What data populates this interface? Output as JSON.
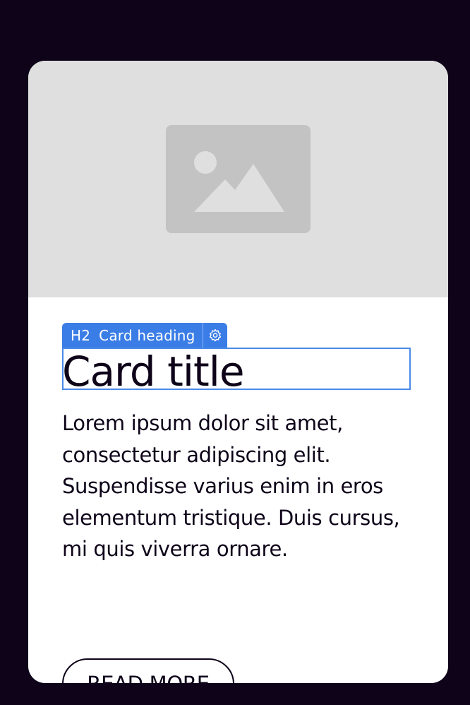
{
  "card": {
    "image": {
      "icon": "image-placeholder-icon",
      "background_color": "#dfdfdf",
      "icon_color": "#c3c3c3"
    },
    "heading_toolbar": {
      "tag": "H2",
      "label": "Card heading",
      "settings_icon": "gear-icon",
      "accent_color": "#3b7de6"
    },
    "title": "Card title",
    "text": "Lorem ipsum dolor sit amet, consectetur adipiscing elit. Suspendisse varius enim in eros elementum tristique. Duis cursus, mi quis viverra ornare.",
    "button_label": "READ MORE"
  },
  "colors": {
    "page_background": "#0e0319",
    "card_background": "#ffffff",
    "text": "#0e0319",
    "selection_outline": "#4a8ae8"
  }
}
